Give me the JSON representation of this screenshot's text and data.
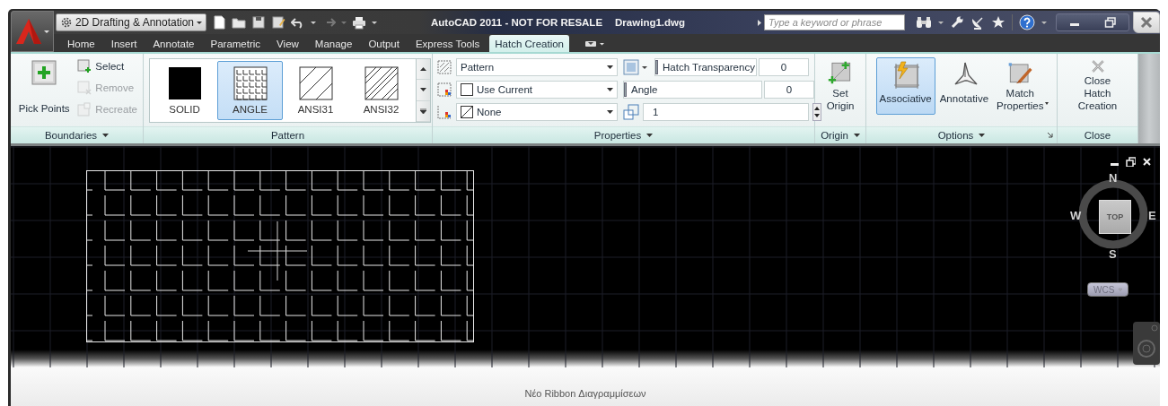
{
  "app_bar": {
    "workspace": "2D Drafting & Annotation",
    "title": "AutoCAD 2011 - NOT FOR RESALE",
    "document": "Drawing1.dwg",
    "search": {
      "placeholder": "Type a keyword or phrase"
    }
  },
  "tabs": [
    {
      "label": "Home",
      "selected": false
    },
    {
      "label": "Insert",
      "selected": false
    },
    {
      "label": "Annotate",
      "selected": false
    },
    {
      "label": "Parametric",
      "selected": false
    },
    {
      "label": "View",
      "selected": false
    },
    {
      "label": "Manage",
      "selected": false
    },
    {
      "label": "Output",
      "selected": false
    },
    {
      "label": "Express Tools",
      "selected": false
    },
    {
      "label": "Hatch Creation",
      "selected": true
    }
  ],
  "ribbon": {
    "panels": [
      {
        "kind": "boundaries",
        "title": "Boundaries",
        "menu": true,
        "large_button": {
          "label": "Pick Points"
        },
        "buttons": [
          {
            "label": "Select",
            "disabled": false
          },
          {
            "label": "Remove",
            "disabled": true
          },
          {
            "label": "Recreate",
            "disabled": true
          }
        ]
      },
      {
        "kind": "gallery",
        "title": "Pattern",
        "items": [
          {
            "label": "SOLID",
            "kind": "solid",
            "selected": false
          },
          {
            "label": "ANGLE",
            "kind": "angle",
            "selected": true
          },
          {
            "label": "ANSI31",
            "kind": "single-hatch",
            "selected": false
          },
          {
            "label": "ANSI32",
            "kind": "double-hatch",
            "selected": false
          }
        ]
      },
      {
        "kind": "properties",
        "title": "Properties",
        "menu": true,
        "dropdowns": [
          {
            "value": "Pattern"
          },
          {
            "value": "Use Current"
          },
          {
            "value": "None"
          }
        ],
        "sliders": [
          {
            "label": "Hatch Transparency",
            "level": 0,
            "value": "0"
          },
          {
            "label": "Angle",
            "level": 0,
            "value": "0"
          }
        ],
        "scale": {
          "value": "1"
        }
      },
      {
        "kind": "buttons",
        "title": "Origin",
        "menu": true,
        "buttons": [
          {
            "label": "Set\nOrigin",
            "selected": false
          }
        ]
      },
      {
        "kind": "buttons",
        "title": "Options",
        "menu": true,
        "launcher": true,
        "buttons": [
          {
            "label": "Associative",
            "selected": true
          },
          {
            "label": "Annotative",
            "selected": false
          },
          {
            "label": "Match\nProperties",
            "selected": false,
            "menu": true
          }
        ]
      },
      {
        "kind": "buttons",
        "title": "Close",
        "buttons": [
          {
            "label": "Close\nHatch Creation",
            "selected": false
          }
        ]
      }
    ]
  },
  "viewcube": {
    "face": "TOP",
    "north": "N",
    "south": "S",
    "east": "E",
    "west": "W",
    "ucs": "WCS"
  },
  "caption": "Νέο Ribbon Διαγραμμίσεων"
}
